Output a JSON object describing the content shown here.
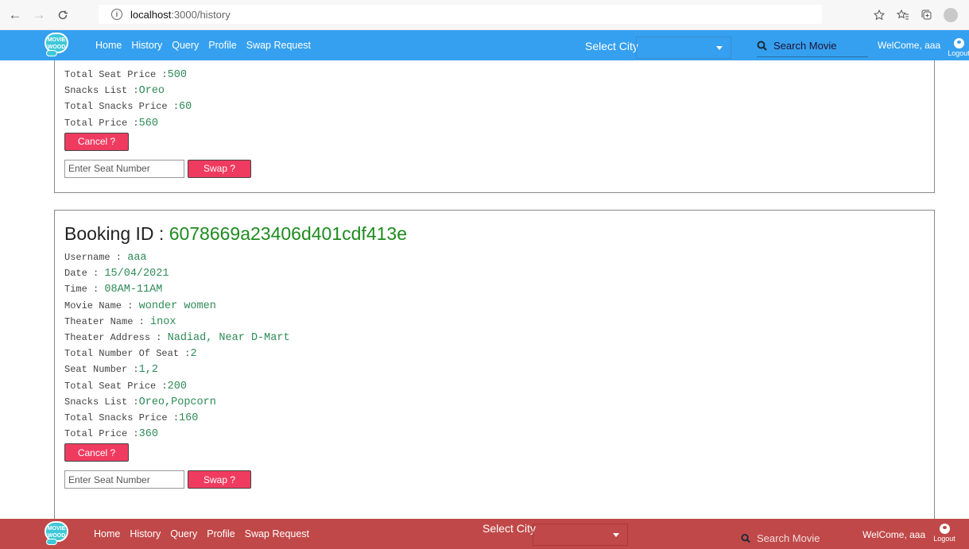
{
  "browser": {
    "url_host": "localhost",
    "url_path": ":3000/history",
    "back_icon": "←",
    "forward_icon": "→",
    "reload_icon": "C"
  },
  "navbar": {
    "logo_text": "MOVIE WOOD",
    "links": [
      "Home",
      "History",
      "Query",
      "Profile",
      "Swap Request"
    ],
    "select_city_label": "Select City",
    "search_placeholder": "Search Movie",
    "welcome": "WelCome, aaa",
    "logout_label": "Logout",
    "top_color": "#35a0ef",
    "bottom_color": "#c14848"
  },
  "bookings": [
    {
      "fields": [
        {
          "label": "Total Seat Price :",
          "value": "500"
        },
        {
          "label": "Snacks List :",
          "value": "Oreo"
        },
        {
          "label": "Total Snacks Price :",
          "value": "60"
        },
        {
          "label": "Total Price :",
          "value": "560"
        }
      ],
      "cancel_label": "Cancel ?",
      "seat_placeholder": "Enter Seat Number",
      "swap_label": "Swap ?"
    },
    {
      "title_label": "Booking ID : ",
      "booking_id": "6078669a23406d401cdf413e",
      "fields": [
        {
          "label": "Username : ",
          "value": "aaa"
        },
        {
          "label": "Date : ",
          "value": "15/04/2021"
        },
        {
          "label": "Time : ",
          "value": "08AM-11AM"
        },
        {
          "label": "Movie Name : ",
          "value": "wonder women"
        },
        {
          "label": "Theater Name : ",
          "value": "inox"
        },
        {
          "label": "Theater Address : ",
          "value": "Nadiad, Near D-Mart"
        },
        {
          "label": "Total Number Of Seat :",
          "value": "2"
        },
        {
          "label": "Seat Number :",
          "value": "1,2"
        },
        {
          "label": "Total Seat Price :",
          "value": "200"
        },
        {
          "label": "Snacks List :",
          "value": "Oreo,Popcorn"
        },
        {
          "label": "Total Snacks Price :",
          "value": "160"
        },
        {
          "label": "Total Price :",
          "value": "360"
        }
      ],
      "cancel_label": "Cancel ?",
      "seat_placeholder": "Enter Seat Number",
      "swap_label": "Swap ?"
    }
  ]
}
